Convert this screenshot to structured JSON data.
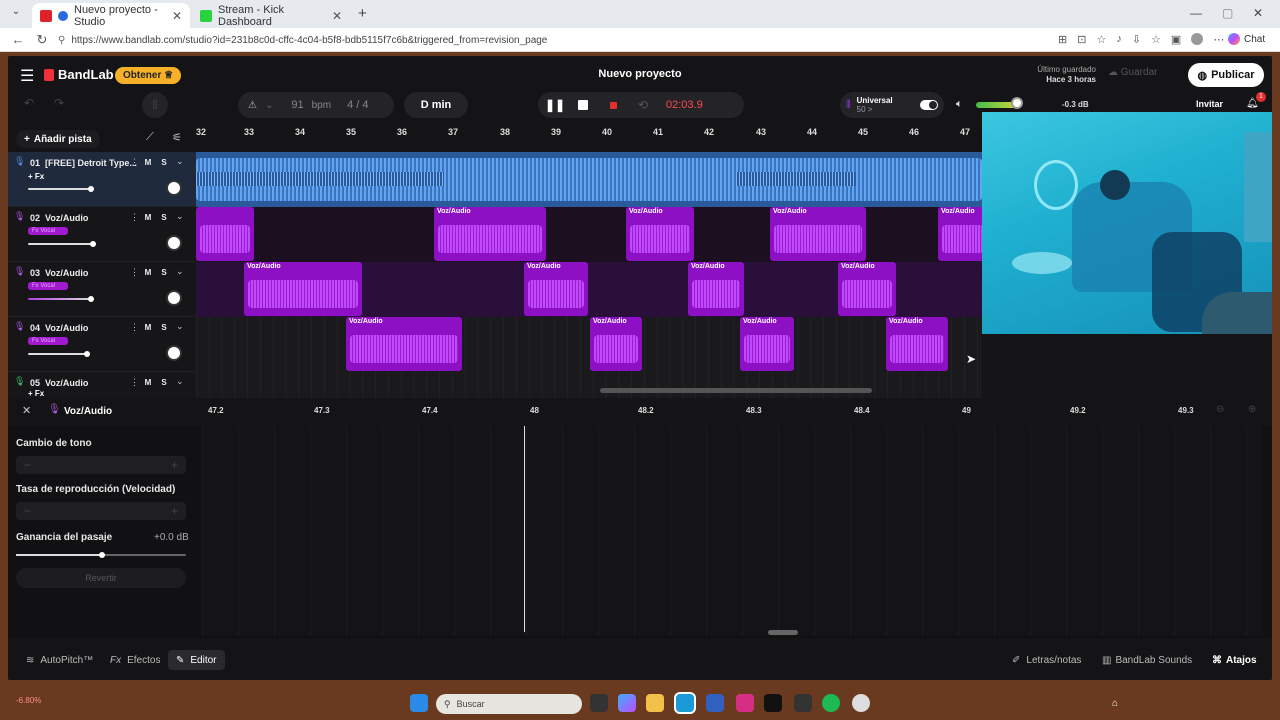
{
  "browser": {
    "tabs": [
      {
        "title": "Nuevo proyecto - Studio",
        "active": true
      },
      {
        "title": "Stream - Kick Dashboard",
        "active": false
      }
    ],
    "url": "https://www.bandlab.com/studio?id=231b8c0d-cffc-4c04-b5f8-bdb5115f7c6b&triggered_from=revision_page",
    "chat_label": "Chat"
  },
  "app": {
    "logo": "BandLab",
    "get_button": "Obtener",
    "project_title": "Nuevo proyecto",
    "saved_label": "Último guardado",
    "saved_time": "Hace 3 horas",
    "save_button": "Guardar",
    "publish_button": "Publicar",
    "invite_button": "Invitar",
    "notification_count": "1"
  },
  "transport": {
    "bpm_value": "91",
    "bpm_label": "bpm",
    "time_signature": "4 / 4",
    "key": "D min",
    "time": "02:03.9",
    "preset_name": "Universal",
    "preset_value": "50 >",
    "volume_db": "-0.3 dB"
  },
  "tracks_panel": {
    "add_track": "Añadir pista",
    "tracks": [
      {
        "number": "01",
        "name": "[FREE] Detroit Type...",
        "fx": "+ Fx",
        "mute": "M",
        "solo": "S"
      },
      {
        "number": "02",
        "name": "Voz/Audio",
        "fx": "Fx Vocal",
        "mute": "M",
        "solo": "S"
      },
      {
        "number": "03",
        "name": "Voz/Audio",
        "fx": "Fx Vocal",
        "mute": "M",
        "solo": "S"
      },
      {
        "number": "04",
        "name": "Voz/Audio",
        "fx": "Fx Vocal",
        "mute": "M",
        "solo": "S"
      },
      {
        "number": "05",
        "name": "Voz/Audio",
        "fx": "+ Fx",
        "mute": "M",
        "solo": "S"
      }
    ]
  },
  "ruler": {
    "ticks": [
      "32",
      "33",
      "34",
      "35",
      "36",
      "37",
      "38",
      "39",
      "40",
      "41",
      "42",
      "43",
      "44",
      "45",
      "46",
      "47"
    ]
  },
  "clips": {
    "label": "Voz/Audio"
  },
  "editor": {
    "track_name": "Voz/Audio",
    "pitch_label": "Cambio de tono",
    "speed_label": "Tasa de reproducción (Velocidad)",
    "gain_label": "Ganancia del pasaje",
    "gain_value": "+0.0 dB",
    "revert_button": "Revertir",
    "ruler": [
      "47.2",
      "47.3",
      "47.4",
      "48",
      "48.2",
      "48.3",
      "48.4",
      "49",
      "49.2",
      "49.3"
    ]
  },
  "bottombar": {
    "autopitch": "AutoPitch™",
    "effects": "Efectos",
    "editor": "Editor",
    "lyrics": "Letras/notas",
    "sounds": "BandLab Sounds",
    "shortcuts": "Atajos"
  },
  "taskbar": {
    "search_placeholder": "Buscar",
    "stock_value": "-6.80%"
  }
}
